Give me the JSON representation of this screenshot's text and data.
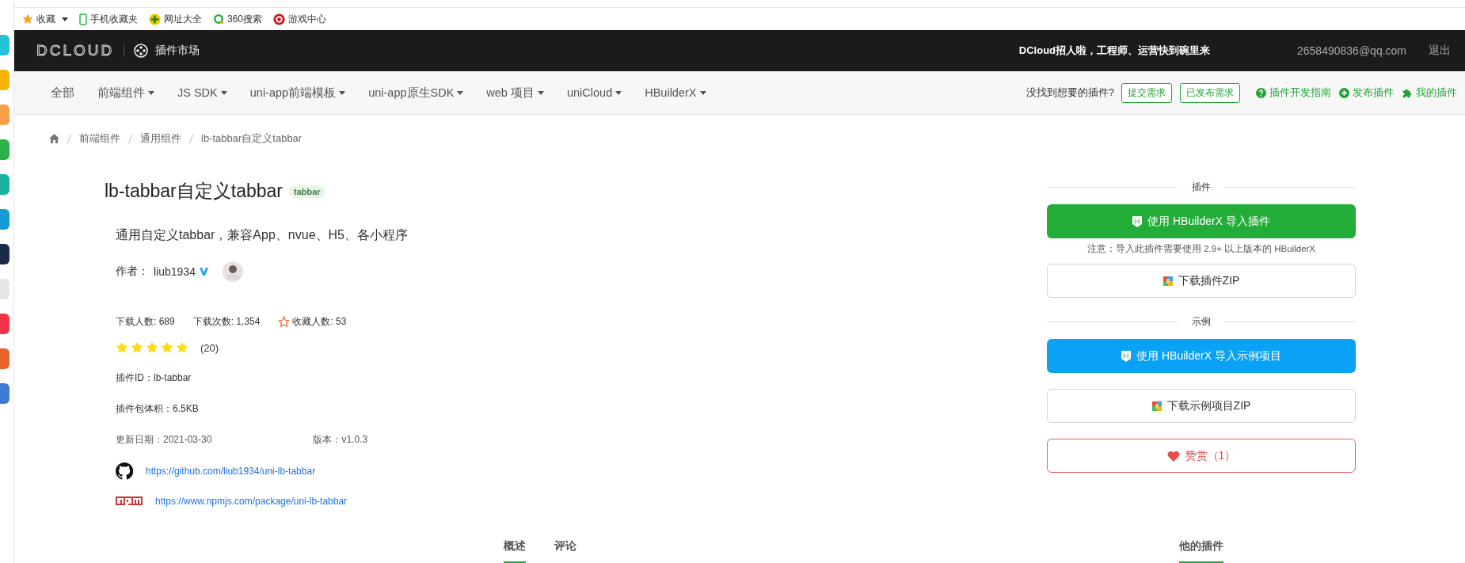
{
  "bookmarks": [
    {
      "label": "收藏",
      "kind": "star",
      "dropdown": true
    },
    {
      "label": "手机收藏夹",
      "kind": "phone",
      "dropdown": false
    },
    {
      "label": "网址大全",
      "kind": "globe",
      "dropdown": false
    },
    {
      "label": "360搜索",
      "kind": "ring",
      "dropdown": false
    },
    {
      "label": "游戏中心",
      "kind": "game",
      "dropdown": false
    }
  ],
  "header": {
    "logo": "DCLOUD",
    "section": "插件市场",
    "notice": "DCloud招人啦，工程师、运营快到碗里来",
    "email": "2658490836@qq.com",
    "logout": "退出"
  },
  "nav": {
    "items": [
      {
        "label": "全部",
        "dropdown": false
      },
      {
        "label": "前端组件",
        "dropdown": true
      },
      {
        "label": "JS SDK",
        "dropdown": true
      },
      {
        "label": "uni-app前端模板",
        "dropdown": true
      },
      {
        "label": "uni-app原生SDK",
        "dropdown": true
      },
      {
        "label": "web 项目",
        "dropdown": true
      },
      {
        "label": "uniCloud",
        "dropdown": true
      },
      {
        "label": "HBuilderX",
        "dropdown": true
      }
    ],
    "question": "没找到想要的插件?",
    "buttons": [
      "提交需求",
      "已发布需求"
    ],
    "links": [
      {
        "label": "插件开发指南",
        "kind": "help"
      },
      {
        "label": "发布插件",
        "kind": "plus"
      },
      {
        "label": "我的插件",
        "kind": "puzzle"
      }
    ]
  },
  "breadcrumb": [
    "前端组件",
    "通用组件",
    "lb-tabbar自定义tabbar"
  ],
  "plugin": {
    "title": "lb-tabbar自定义tabbar",
    "tag": "tabbar",
    "description": "通用自定义tabbar，兼容App、nvue、H5、各小程序",
    "author_label": "作者：",
    "author": "liub1934",
    "verified": true,
    "stats": [
      {
        "text": "下载人数: 689",
        "kind": "plain"
      },
      {
        "text": "下载次数: 1,354",
        "kind": "plain"
      },
      {
        "text": "收藏人数: 53",
        "kind": "favorite"
      }
    ],
    "stars": 5,
    "rating_count": "(20)",
    "plugin_id": "插件ID：lb-tabbar",
    "size": "插件包体积：6.5KB",
    "updated": "更新日期：2021-03-30",
    "version": "版本：v1.0.3",
    "links": [
      {
        "url": "https://github.com/liub1934/uni-lb-tabbar",
        "kind": "github"
      },
      {
        "url": "https://www.npmjs.com/package/uni-lb-tabbar",
        "kind": "npm"
      }
    ]
  },
  "sidebar_panel": [
    {
      "kind": "divider",
      "label": "插件"
    },
    {
      "kind": "green",
      "label": "使用 HBuilderX 导入插件"
    },
    {
      "kind": "note",
      "label": "注意：导入此插件需要使用 2.9+ 以上版本的 HBuilderX"
    },
    {
      "kind": "outline",
      "label": "下载插件ZIP"
    },
    {
      "kind": "divider",
      "label": "示例"
    },
    {
      "kind": "blue",
      "label": "使用 HBuilderX 导入示例项目"
    },
    {
      "kind": "outline",
      "label": "下载示例项目ZIP"
    },
    {
      "kind": "reward",
      "label": "赞赏（1）"
    }
  ],
  "tabs": [
    {
      "label": "概述",
      "selected": true
    },
    {
      "label": "评论",
      "selected": false
    }
  ],
  "other_tab": {
    "label": "他的插件",
    "selected": true
  }
}
